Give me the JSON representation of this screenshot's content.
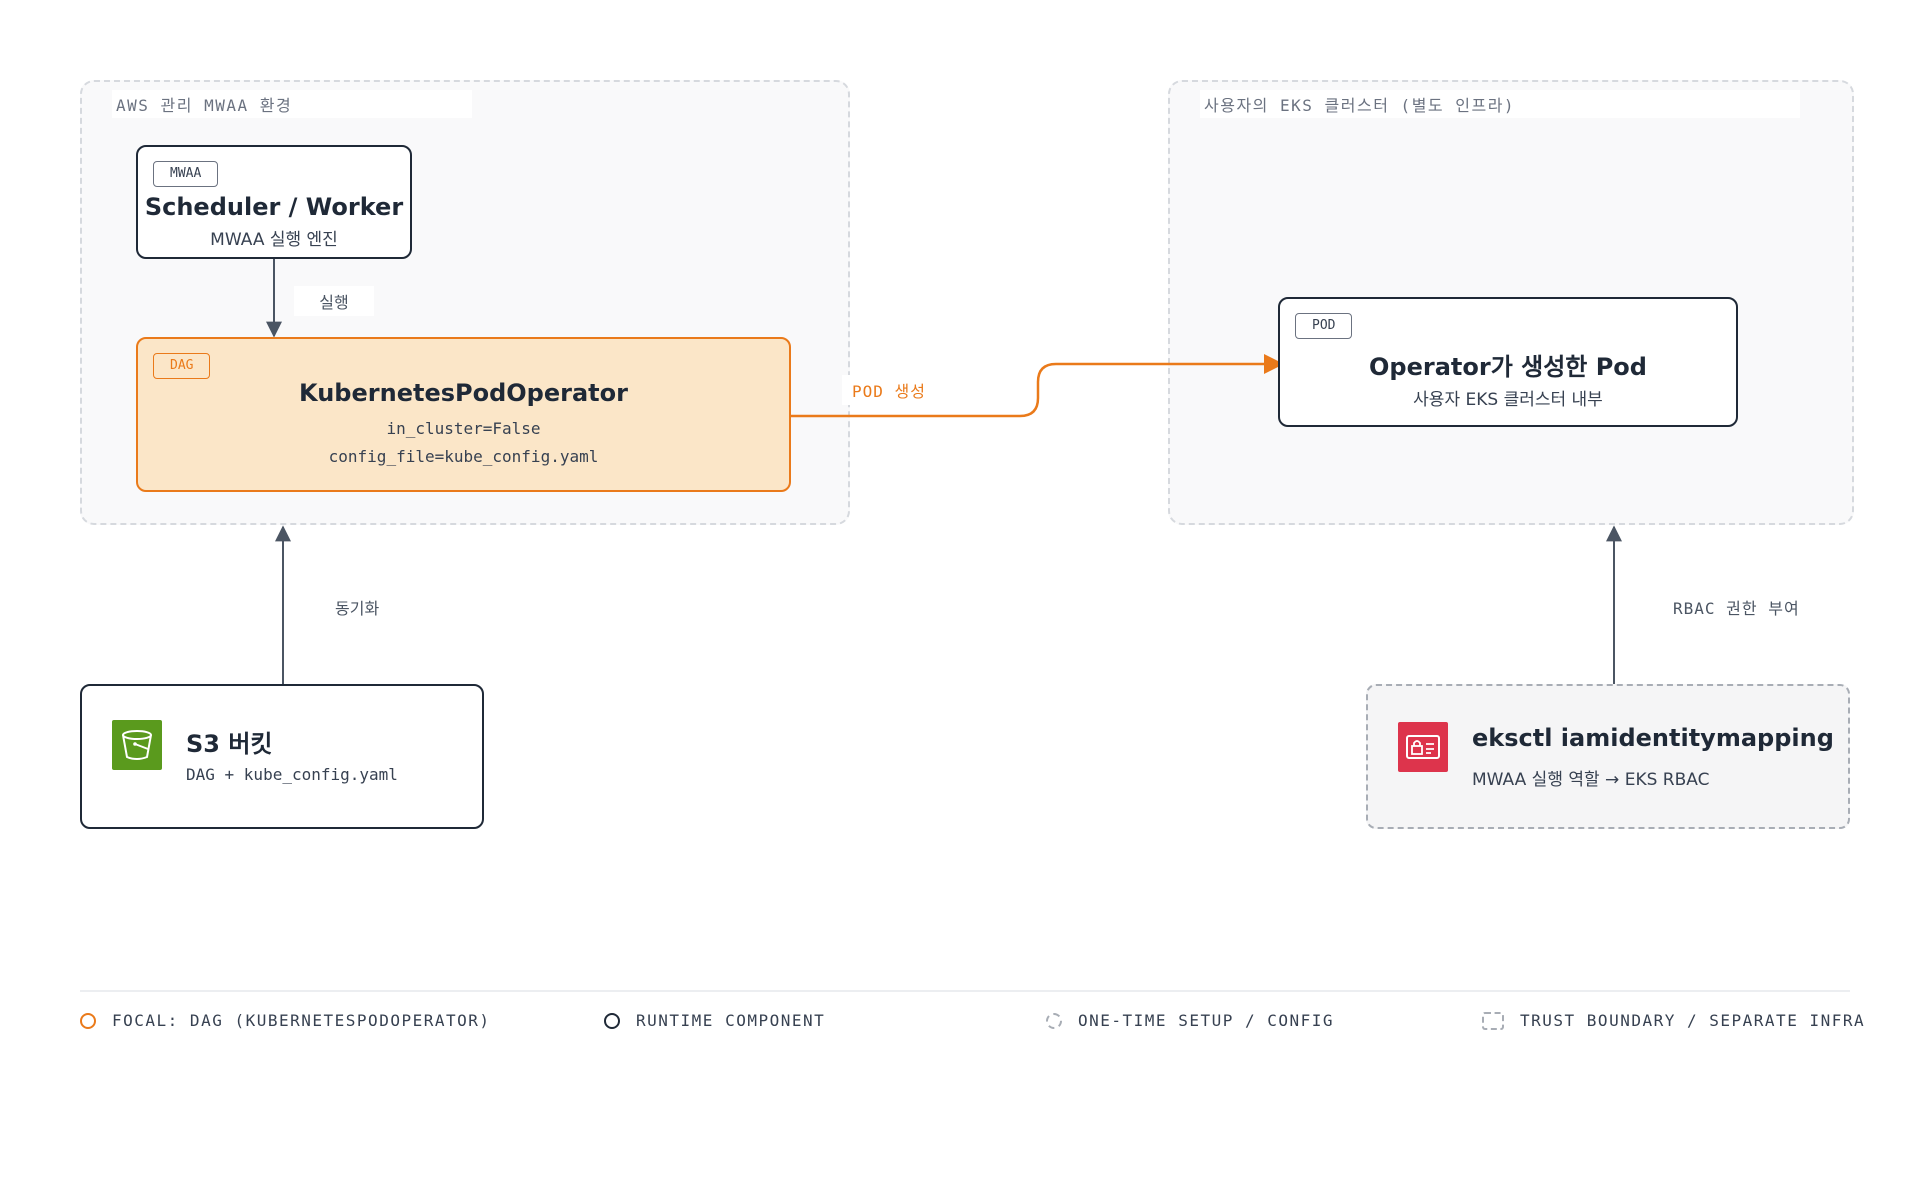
{
  "boundaries": {
    "mwaa": {
      "label": "AWS 관리 MWAA 환경"
    },
    "eks": {
      "label": "사용자의 EKS 클러스터 (별도 인프라)"
    }
  },
  "nodes": {
    "scheduler": {
      "tag": "MWAA",
      "title": "Scheduler / Worker",
      "subtitle": "MWAA 실행 엔진"
    },
    "operator": {
      "tag": "DAG",
      "title": "KubernetesPodOperator",
      "line1": "in_cluster=False",
      "line2": "config_file=kube_config.yaml"
    },
    "pod": {
      "tag": "POD",
      "title": "Operator가 생성한 Pod",
      "subtitle": "사용자 EKS 클러스터 내부"
    },
    "s3": {
      "title": "S3 버킷",
      "subtitle": "DAG + kube_config.yaml",
      "icon": "s3-bucket-icon"
    },
    "eksctl": {
      "title": "eksctl iamidentitymapping",
      "subtitle": "MWAA 실행 역할 → EKS RBAC",
      "icon": "identity-card-lock-icon"
    }
  },
  "edges": {
    "run": "실행",
    "create_pod": "POD 생성",
    "sync": "동기화",
    "rbac": "RBAC 권한 부여"
  },
  "legend": {
    "focal": "FOCAL: DAG (KUBERNETESPODOPERATOR)",
    "runtime": "RUNTIME COMPONENT",
    "setup": "ONE-TIME SETUP / CONFIG",
    "boundary": "TRUST BOUNDARY / SEPARATE INFRA"
  },
  "colors": {
    "focal_accent": "#ea7a1a",
    "focal_fill": "#fbe6c8",
    "s3_icon": "#5a9a1d",
    "iam_icon": "#dd344c",
    "stroke": "#1f2937"
  }
}
